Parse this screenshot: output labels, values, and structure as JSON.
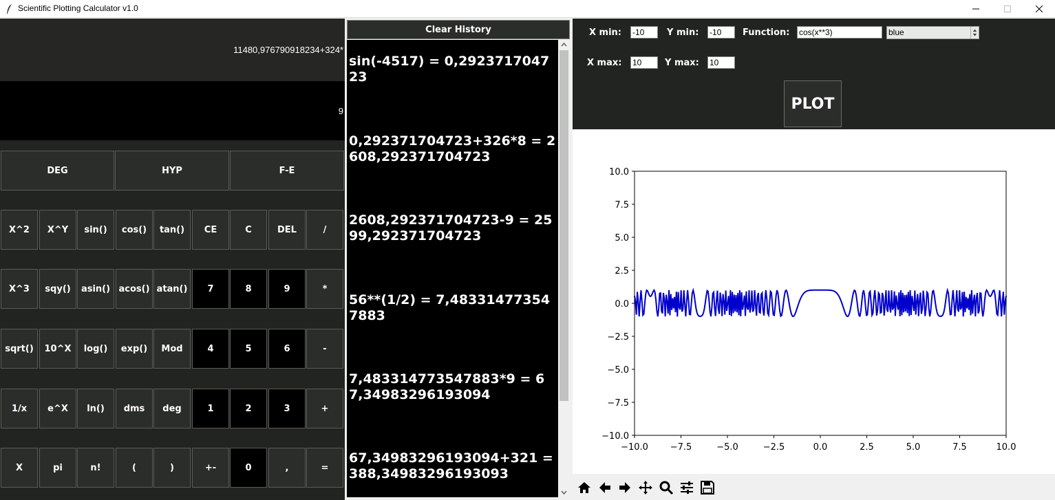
{
  "window": {
    "title": "Scientific Plotting Calculator v1.0"
  },
  "calculator": {
    "expression": "11480,976790918234+324*",
    "result": "9",
    "mode_buttons": [
      {
        "name": "deg-mode-button",
        "label": "DEG"
      },
      {
        "name": "hyp-mode-button",
        "label": "HYP"
      },
      {
        "name": "fe-mode-button",
        "label": "F-E"
      }
    ],
    "rows": [
      [
        {
          "name": "square-button",
          "label": "X^2"
        },
        {
          "name": "power-button",
          "label": "X^Y"
        },
        {
          "name": "sin-button",
          "label": "sin()"
        },
        {
          "name": "cos-button",
          "label": "cos()"
        },
        {
          "name": "tan-button",
          "label": "tan()"
        },
        {
          "name": "clear-entry-button",
          "label": "CE"
        },
        {
          "name": "clear-button",
          "label": "C"
        },
        {
          "name": "delete-button",
          "label": "DEL"
        },
        {
          "name": "divide-button",
          "label": "/"
        }
      ],
      [
        {
          "name": "cube-button",
          "label": "X^3"
        },
        {
          "name": "sqy-button",
          "label": "sqy()"
        },
        {
          "name": "asin-button",
          "label": "asin()"
        },
        {
          "name": "acos-button",
          "label": "acos()"
        },
        {
          "name": "atan-button",
          "label": "atan()"
        },
        {
          "name": "digit-7-button",
          "label": "7",
          "digit": true
        },
        {
          "name": "digit-8-button",
          "label": "8",
          "digit": true
        },
        {
          "name": "digit-9-button",
          "label": "9",
          "digit": true
        },
        {
          "name": "multiply-button",
          "label": "*"
        }
      ],
      [
        {
          "name": "sqrt-button",
          "label": "sqrt()"
        },
        {
          "name": "ten-power-button",
          "label": "10^X"
        },
        {
          "name": "log-button",
          "label": "log()"
        },
        {
          "name": "exp-button",
          "label": "exp()"
        },
        {
          "name": "mod-button",
          "label": "Mod"
        },
        {
          "name": "digit-4-button",
          "label": "4",
          "digit": true
        },
        {
          "name": "digit-5-button",
          "label": "5",
          "digit": true
        },
        {
          "name": "digit-6-button",
          "label": "6",
          "digit": true
        },
        {
          "name": "subtract-button",
          "label": "-"
        }
      ],
      [
        {
          "name": "reciprocal-button",
          "label": "1/x"
        },
        {
          "name": "e-power-button",
          "label": "e^X"
        },
        {
          "name": "ln-button",
          "label": "ln()"
        },
        {
          "name": "dms-button",
          "label": "dms"
        },
        {
          "name": "deg-button",
          "label": "deg"
        },
        {
          "name": "digit-1-button",
          "label": "1",
          "digit": true
        },
        {
          "name": "digit-2-button",
          "label": "2",
          "digit": true
        },
        {
          "name": "digit-3-button",
          "label": "3",
          "digit": true
        },
        {
          "name": "add-button",
          "label": "+"
        }
      ],
      [
        {
          "name": "x-variable-button",
          "label": "X"
        },
        {
          "name": "pi-button",
          "label": "pi"
        },
        {
          "name": "factorial-button",
          "label": "n!"
        },
        {
          "name": "open-paren-button",
          "label": "("
        },
        {
          "name": "close-paren-button",
          "label": ")"
        },
        {
          "name": "plus-minus-button",
          "label": "+-"
        },
        {
          "name": "digit-0-button",
          "label": "0",
          "digit": true
        },
        {
          "name": "comma-button",
          "label": ","
        },
        {
          "name": "equals-button",
          "label": "="
        }
      ]
    ]
  },
  "history": {
    "clear_label": "Clear History",
    "items": [
      "sin(-4517) = 0,292371704723",
      "0,292371704723+326*8 = 2608,292371704723",
      "2608,292371704723-9 = 2599,292371704723",
      "56**(1/2) = 7,483314773547883",
      "7,483314773547883*9 = 67,34983296193094",
      "67,34983296193094+321 = 388,3498329619309​3"
    ]
  },
  "plot_controls": {
    "xmin_label": "X min:",
    "xmin_value": "-10",
    "ymin_label": "Y min:",
    "ymin_value": "-10",
    "function_label": "Function:",
    "function_value": "cos(x**3)",
    "color_value": "blue",
    "xmax_label": "X max:",
    "xmax_value": "10",
    "ymax_label": "Y max:",
    "ymax_value": "10",
    "plot_label": "PLOT"
  },
  "chart_data": {
    "type": "line",
    "function": "cos(x**3)",
    "xlim": [
      -10,
      10
    ],
    "ylim": [
      -10,
      10
    ],
    "samples": 400,
    "color": "#0000cc",
    "x_ticks": [
      "−10.0",
      "−7.5",
      "−5.0",
      "−2.5",
      "0.0",
      "2.5",
      "5.0",
      "7.5",
      "10.0"
    ],
    "y_ticks": [
      "10.0",
      "7.5",
      "5.0",
      "2.5",
      "0.0",
      "−2.5",
      "−5.0",
      "−7.5",
      "−10.0"
    ],
    "x_tick_values": [
      -10,
      -7.5,
      -5,
      -2.5,
      0,
      2.5,
      5,
      7.5,
      10
    ],
    "y_tick_values": [
      10,
      7.5,
      5,
      2.5,
      0,
      -2.5,
      -5,
      -7.5,
      -10
    ],
    "grid": false,
    "title": "",
    "xlabel": "",
    "ylabel": ""
  },
  "toolbar": {
    "tools": [
      {
        "name": "home-icon"
      },
      {
        "name": "back-icon"
      },
      {
        "name": "forward-icon"
      },
      {
        "name": "pan-icon"
      },
      {
        "name": "zoom-icon"
      },
      {
        "name": "configure-subplots-icon"
      },
      {
        "name": "save-icon"
      }
    ]
  }
}
